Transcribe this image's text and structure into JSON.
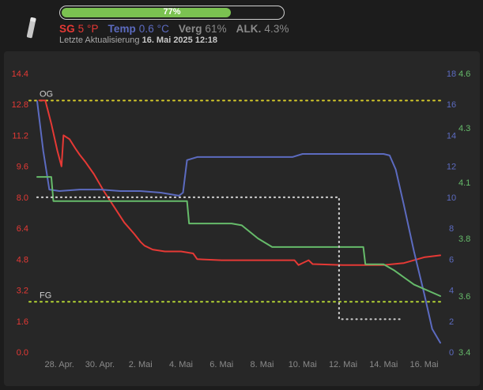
{
  "header": {
    "icon": "hydrometer-icon",
    "progress": {
      "value": 0.77,
      "label": "77%"
    },
    "stats": [
      {
        "label": "SG",
        "value": "5 °P",
        "color": "#e53935"
      },
      {
        "label": "Temp",
        "value": "0.6 °C",
        "color": "#5c6bc0"
      },
      {
        "label": "Verg",
        "value": "61%",
        "color": "#8a8a8a"
      },
      {
        "label": "ALK.",
        "value": "4.3%",
        "color": "#8a8a8a"
      }
    ],
    "updated_prefix": "Letzte Aktualisierung",
    "updated_value": "16. Mai 2025 12:18"
  },
  "chart_data": {
    "type": "line",
    "title": "",
    "x_labels": [
      "28. Apr.",
      "30. Apr.",
      "2. Mai",
      "4. Mai",
      "6. Mai",
      "8. Mai",
      "10. Mai",
      "12. Mai",
      "14. Mai",
      "16. Mai"
    ],
    "x_range": [
      26.5,
      16.8
    ],
    "x_tick_days": [
      28,
      30,
      32,
      34,
      36,
      38,
      40,
      42,
      44,
      46
    ],
    "axes": {
      "left": {
        "min": 0.0,
        "max": 14.4,
        "ticks": [
          "0.0",
          "1.6",
          "3.2",
          "4.8",
          "6.4",
          "8.0",
          "9.6",
          "11.2",
          "12.8",
          "14.4"
        ],
        "color": "#e53935"
      },
      "right_temp": {
        "min": 0,
        "max": 18,
        "ticks": [
          "0",
          "2",
          "4",
          "6",
          "8",
          "10",
          "12",
          "14",
          "16",
          "18"
        ],
        "color": "#5c6bc0"
      },
      "right_alk": {
        "min": 3.4,
        "max": 4.6,
        "ticks": [
          "3.4",
          "3.6",
          "3.8",
          "4.1",
          "4.3",
          "4.6"
        ],
        "color": "#66bb6a"
      }
    },
    "reference_lines": [
      {
        "label": "OG",
        "value": 13.0,
        "color": "#d4c92a"
      },
      {
        "label": "FG",
        "value": 2.6,
        "color": "#b3d334"
      }
    ],
    "series": [
      {
        "name": "SG",
        "axis": "left",
        "color": "#e53935",
        "points": [
          [
            27.0,
            13.0
          ],
          [
            27.3,
            13.0
          ],
          [
            27.6,
            11.8
          ],
          [
            27.9,
            10.4
          ],
          [
            28.1,
            9.6
          ],
          [
            28.2,
            11.2
          ],
          [
            28.5,
            11.0
          ],
          [
            28.8,
            10.5
          ],
          [
            29.0,
            10.2
          ],
          [
            29.3,
            9.8
          ],
          [
            29.7,
            9.2
          ],
          [
            30.2,
            8.3
          ],
          [
            30.7,
            7.5
          ],
          [
            31.2,
            6.7
          ],
          [
            31.7,
            6.1
          ],
          [
            32.0,
            5.7
          ],
          [
            32.2,
            5.5
          ],
          [
            32.6,
            5.3
          ],
          [
            33.2,
            5.2
          ],
          [
            34.0,
            5.2
          ],
          [
            34.6,
            5.1
          ],
          [
            34.8,
            4.8
          ],
          [
            36.0,
            4.75
          ],
          [
            38.0,
            4.75
          ],
          [
            39.6,
            4.75
          ],
          [
            39.8,
            4.5
          ],
          [
            40.3,
            4.75
          ],
          [
            40.5,
            4.55
          ],
          [
            42.0,
            4.5
          ],
          [
            44.0,
            4.5
          ],
          [
            45.0,
            4.6
          ],
          [
            46.0,
            4.9
          ],
          [
            46.8,
            5.0
          ]
        ]
      },
      {
        "name": "Temp",
        "axis": "right_temp",
        "color": "#5c6bc0",
        "points": [
          [
            26.9,
            16.2
          ],
          [
            27.2,
            13.0
          ],
          [
            27.5,
            10.5
          ],
          [
            28.0,
            10.4
          ],
          [
            29.0,
            10.5
          ],
          [
            30.0,
            10.5
          ],
          [
            31.0,
            10.4
          ],
          [
            32.0,
            10.4
          ],
          [
            33.0,
            10.3
          ],
          [
            33.9,
            10.1
          ],
          [
            34.1,
            10.3
          ],
          [
            34.3,
            12.4
          ],
          [
            34.8,
            12.6
          ],
          [
            36.0,
            12.6
          ],
          [
            38.0,
            12.6
          ],
          [
            39.5,
            12.6
          ],
          [
            40.0,
            12.8
          ],
          [
            42.0,
            12.8
          ],
          [
            44.0,
            12.8
          ],
          [
            44.3,
            12.7
          ],
          [
            44.6,
            11.8
          ],
          [
            45.0,
            9.5
          ],
          [
            45.5,
            6.5
          ],
          [
            46.0,
            3.8
          ],
          [
            46.4,
            1.5
          ],
          [
            46.8,
            0.6
          ]
        ]
      },
      {
        "name": "ALK",
        "axis": "right_alk",
        "color": "#66bb6a",
        "points": [
          [
            26.9,
            4.12
          ],
          [
            27.6,
            4.12
          ],
          [
            27.7,
            4.0
          ],
          [
            33.5,
            4.0
          ],
          [
            34.3,
            4.0
          ],
          [
            34.4,
            3.88
          ],
          [
            36.5,
            3.88
          ],
          [
            37.0,
            3.87
          ],
          [
            37.8,
            3.8
          ],
          [
            38.5,
            3.77
          ],
          [
            40.0,
            3.77
          ],
          [
            42.0,
            3.77
          ],
          [
            43.0,
            3.77
          ],
          [
            43.1,
            3.71
          ],
          [
            44.0,
            3.71
          ],
          [
            44.5,
            3.69
          ],
          [
            45.5,
            3.64
          ],
          [
            46.8,
            3.6
          ]
        ]
      },
      {
        "name": "Verg",
        "axis": "left",
        "color": "#c8c8c8",
        "dashed": true,
        "points": [
          [
            26.9,
            8.0
          ],
          [
            41.8,
            8.0
          ],
          [
            41.8,
            1.7
          ],
          [
            44.8,
            1.7
          ]
        ]
      }
    ]
  }
}
